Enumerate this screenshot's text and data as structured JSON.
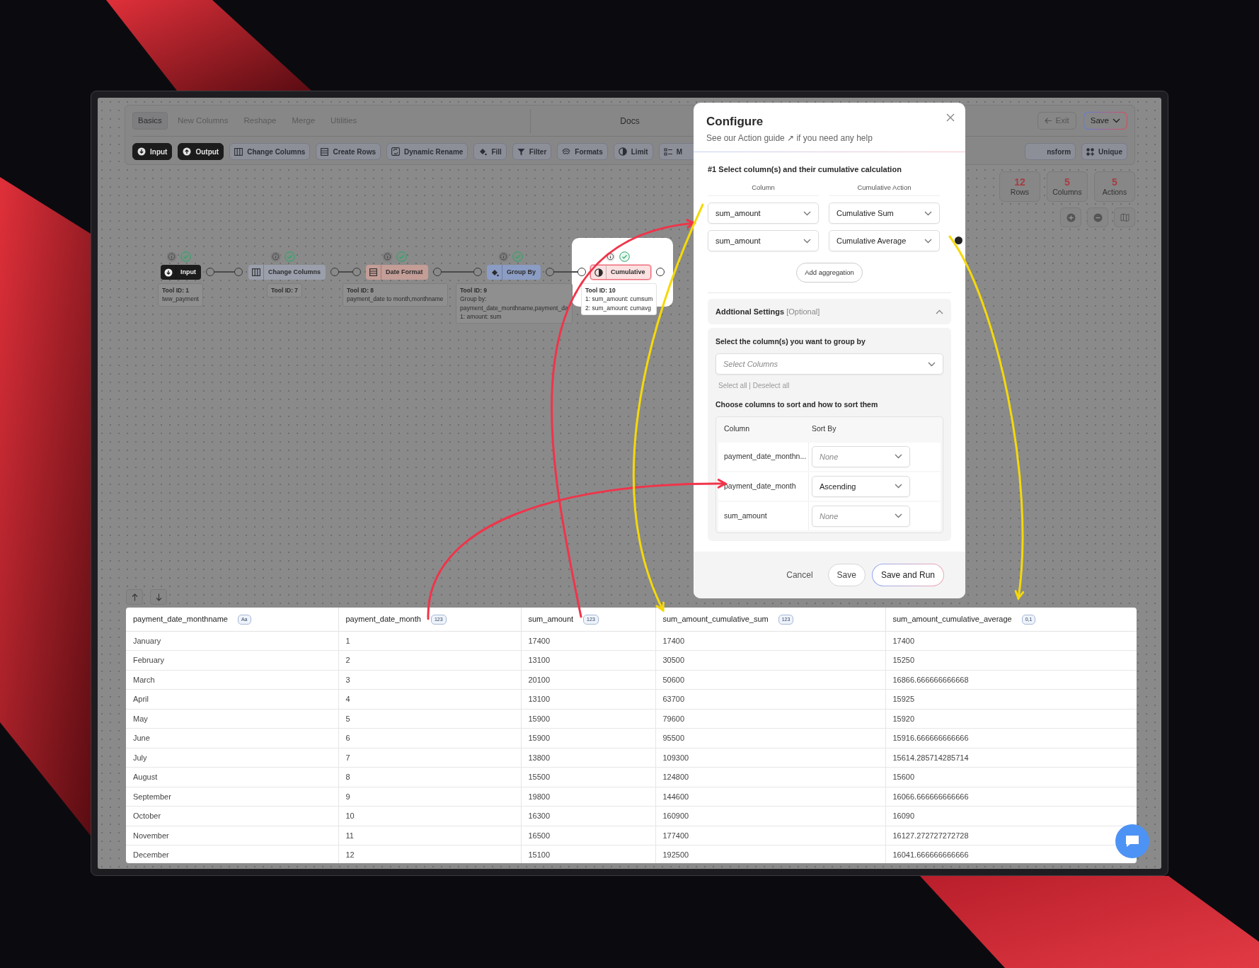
{
  "toolbar": {
    "tabs": [
      {
        "label": "Basics",
        "selected": true
      },
      {
        "label": "New Columns",
        "selected": false
      },
      {
        "label": "Reshape",
        "selected": false
      },
      {
        "label": "Merge",
        "selected": false
      },
      {
        "label": "Utilities",
        "selected": false
      }
    ],
    "docs": "Docs",
    "exit": "Exit",
    "save": "Save",
    "tools_left": [
      {
        "label": "Input",
        "kind": "dark"
      },
      {
        "label": "Output",
        "kind": "dark"
      },
      {
        "label": "Change Columns",
        "kind": "plain"
      },
      {
        "label": "Create Rows",
        "kind": "plain"
      },
      {
        "label": "Dynamic Rename",
        "kind": "plain"
      },
      {
        "label": "Fill",
        "kind": "plain"
      },
      {
        "label": "Filter",
        "kind": "plain"
      },
      {
        "label": "Formats",
        "kind": "plain"
      },
      {
        "label": "Limit",
        "kind": "plain"
      },
      {
        "label": "M",
        "kind": "plain"
      }
    ],
    "tools_right": [
      {
        "label": "nsform",
        "kind": "plain"
      },
      {
        "label": "Unique",
        "kind": "plain"
      }
    ]
  },
  "stats": [
    {
      "value": "12",
      "label": "Rows"
    },
    {
      "value": "5",
      "label": "Columns"
    },
    {
      "value": "5",
      "label": "Actions"
    }
  ],
  "pipeline": {
    "nodes": [
      {
        "label": "Input",
        "color": "#1c1c1c",
        "selected": false,
        "tool_id": "Tool ID: 1",
        "details": [
          "tww_payment"
        ]
      },
      {
        "label": "Change Columns",
        "color": "#9a9fab",
        "selected": false,
        "tool_id": "Tool ID: 7"
      },
      {
        "label": "Date Format",
        "color": "#c49d97",
        "selected": false,
        "tool_id": "Tool ID: 8",
        "details": [
          "payment_date to month,monthname"
        ]
      },
      {
        "label": "Group By",
        "color": "#8b9dc4",
        "selected": false,
        "tool_id": "Tool ID: 9",
        "details": [
          "Group by:",
          "payment_date_monthname,payment_da",
          "1: amount: sum"
        ]
      },
      {
        "label": "Cumulative",
        "color": "#fbe1e1",
        "selected": true,
        "tool_id": "Tool ID: 10",
        "details": [
          "1: sum_amount: cumsum",
          "2: sum_amount: cumavg"
        ]
      }
    ]
  },
  "modal": {
    "title": "Configure",
    "help_prefix": "See our",
    "help_link": "Action guide ↗",
    "help_suffix": "if you need any help",
    "step_title": "#1 Select column(s) and their cumulative calculation",
    "column_heading": "Column",
    "action_heading": "Cumulative Action",
    "aggregations": [
      {
        "column": "sum_amount",
        "action": "Cumulative Sum",
        "removable": false
      },
      {
        "column": "sum_amount",
        "action": "Cumulative Average",
        "removable": true
      }
    ],
    "add_button": "Add aggregation",
    "settings": {
      "title": "Addtional Settings",
      "optional": "[Optional]",
      "expanded": true,
      "group_label": "Select the column(s) you want to group by",
      "group_placeholder": "Select Columns",
      "select_all": "Select all | Deselect all",
      "sort_label": "Choose columns to sort and how to sort them",
      "sort_column_heading": "Column",
      "sort_by_heading": "Sort By",
      "sort_rows": [
        {
          "column": "payment_date_monthn...",
          "placeholder": "None"
        },
        {
          "column": "payment_date_month",
          "value": "Ascending"
        },
        {
          "column": "sum_amount",
          "placeholder": "None"
        }
      ]
    },
    "cancel": "Cancel",
    "save": "Save",
    "save_run": "Save and Run"
  },
  "table": {
    "columns": [
      {
        "name": "payment_date_monthname",
        "type": "Aa"
      },
      {
        "name": "payment_date_month",
        "type": "123"
      },
      {
        "name": "sum_amount",
        "type": "123"
      },
      {
        "name": "sum_amount_cumulative_sum",
        "type": "123"
      },
      {
        "name": "sum_amount_cumulative_average",
        "type": "0,1"
      }
    ],
    "rows": [
      [
        "January",
        "1",
        "17400",
        "17400",
        "17400"
      ],
      [
        "February",
        "2",
        "13100",
        "30500",
        "15250"
      ],
      [
        "March",
        "3",
        "20100",
        "50600",
        "16866.666666666668"
      ],
      [
        "April",
        "4",
        "13100",
        "63700",
        "15925"
      ],
      [
        "May",
        "5",
        "15900",
        "79600",
        "15920"
      ],
      [
        "June",
        "6",
        "15900",
        "95500",
        "15916.666666666666"
      ],
      [
        "July",
        "7",
        "13800",
        "109300",
        "15614.285714285714"
      ],
      [
        "August",
        "8",
        "15500",
        "124800",
        "15600"
      ],
      [
        "September",
        "9",
        "19800",
        "144600",
        "16066.666666666666"
      ],
      [
        "October",
        "10",
        "16300",
        "160900",
        "16090"
      ],
      [
        "November",
        "11",
        "16500",
        "177400",
        "16127.272727272728"
      ],
      [
        "December",
        "12",
        "15100",
        "192500",
        "16041.666666666666"
      ]
    ]
  },
  "annotation_arrows": [
    {
      "color": "#f0344a"
    },
    {
      "color": "#f0344a"
    },
    {
      "color": "#f5d90a"
    },
    {
      "color": "#f5d90a"
    }
  ]
}
